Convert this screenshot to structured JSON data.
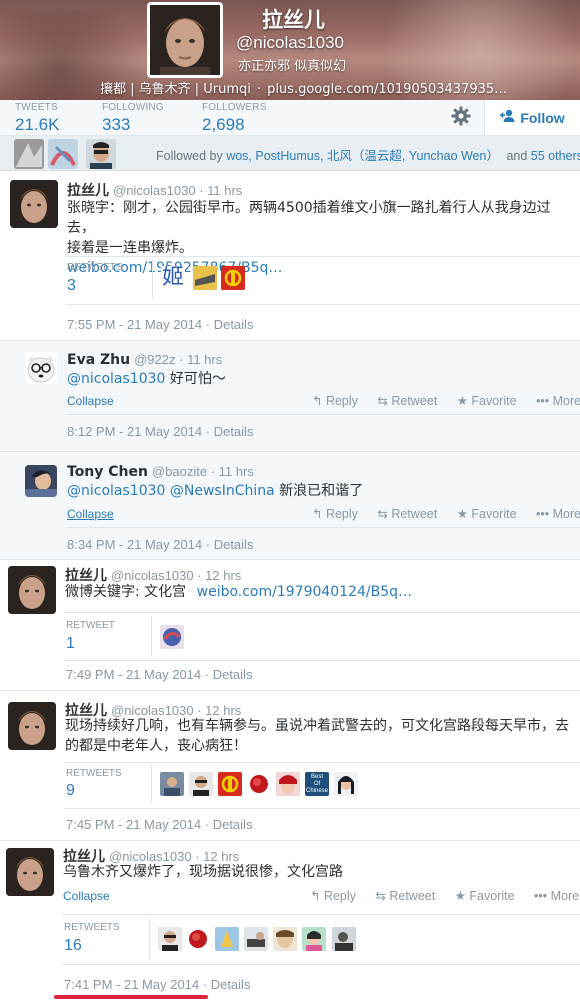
{
  "profile": {
    "name": "拉丝儿",
    "handle": "@nicolas1030",
    "bio": "亦正亦邪 似真似幻",
    "location": "攘都 | 乌鲁木齐 | Urumqi",
    "url": "plus.google.com/10190503437935…"
  },
  "stats": {
    "tweets_label": "TWEETS",
    "tweets": "21.6K",
    "following_label": "FOLLOWING",
    "following": "333",
    "followers_label": "FOLLOWERS",
    "followers": "2,698",
    "follow_button": "Follow"
  },
  "followed_by": {
    "prefix": "Followed by",
    "names": "wos, PostHumus, 北风（温云超, Yunchao Wen）",
    "and": "and",
    "others": "55 others."
  },
  "tweets": [
    {
      "name": "拉丝儿",
      "handle": "@nicolas1030",
      "time": "· 11 hrs",
      "text1": "张晓宇：刚才，公园街早市。两辆4500插着维文小旗一路扎着行人从我身边过去，",
      "text2": "接着是一连串爆炸。",
      "link": "weibo.com/1959257867/B5q…",
      "retweets_label": "RETWEETS",
      "retweets": "3",
      "date": "7:55 PM - 21 May 2014",
      "details": "· Details"
    },
    {
      "name": "拉丝儿",
      "handle": "@nicolas1030",
      "time": "· 12 hrs",
      "text_prefix": "微博关键字: 文化宫",
      "link": "weibo.com/1979040124/B5q…",
      "retweets_label": "RETWEET",
      "retweets": "1",
      "date": "7:49 PM - 21 May 2014",
      "details": "· Details"
    },
    {
      "name": "拉丝儿",
      "handle": "@nicolas1030",
      "time": "· 12 hrs",
      "text1": "现场持续好几响，也有车辆参与。虽说冲着武警去的，可文化宫路段每天早市，去",
      "text2": "的都是中老年人，丧心病狂！",
      "retweets_label": "RETWEETS",
      "retweets": "9",
      "date": "7:45 PM - 21 May 2014",
      "details": "· Details"
    },
    {
      "name": "拉丝儿",
      "handle": "@nicolas1030",
      "time": "· 12 hrs",
      "text": "乌鲁木齐又爆炸了，现场据说很惨，文化宫路",
      "collapse": "Collapse",
      "retweets_label": "RETWEETS",
      "retweets": "16",
      "date": "7:41 PM - 21 May 2014",
      "details": "· Details"
    }
  ],
  "replies": [
    {
      "name": "Eva Zhu",
      "handle": "@922z",
      "time": "· 11 hrs",
      "mention": "@nicolas1030",
      "text": "好可怕～",
      "collapse": "Collapse",
      "date": "8:12 PM - 21 May 2014",
      "details": "· Details"
    },
    {
      "name": "Tony Chen",
      "handle": "@baozite",
      "time": "· 11 hrs",
      "mention": "@nicolas1030",
      "mention2": "@NewsInChina",
      "text": "新浪已和谐了",
      "collapse": "Collapse",
      "date": "8:34 PM - 21 May 2014",
      "details": "· Details"
    }
  ],
  "actions": {
    "reply": "Reply",
    "retweet": "Retweet",
    "favorite": "Favorite",
    "more": "More"
  },
  "retweeter_tile": {
    "ji_char": "姬",
    "best_line1": "Best",
    "best_line2": "Of",
    "best_line3": "Chinese"
  },
  "colors": {
    "link": "#2b7bb9",
    "muted": "#8899a6",
    "highlight_underline": "#e0243b"
  }
}
